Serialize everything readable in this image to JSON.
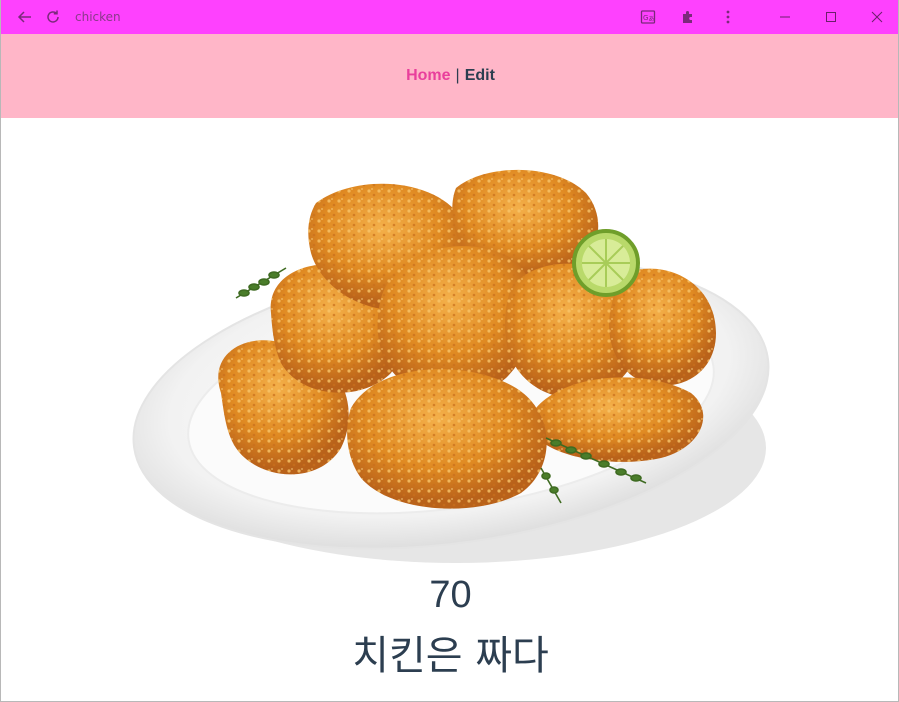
{
  "window": {
    "title": "chicken"
  },
  "nav": {
    "home_label": "Home",
    "separator": "|",
    "edit_label": "Edit"
  },
  "item": {
    "price": "70",
    "description": "치킨은 짜다"
  },
  "colors": {
    "titlebar": "#fe41fe",
    "navbar": "#ffb6c8",
    "link_active": "#e93f9c",
    "text": "#2c3e50"
  }
}
